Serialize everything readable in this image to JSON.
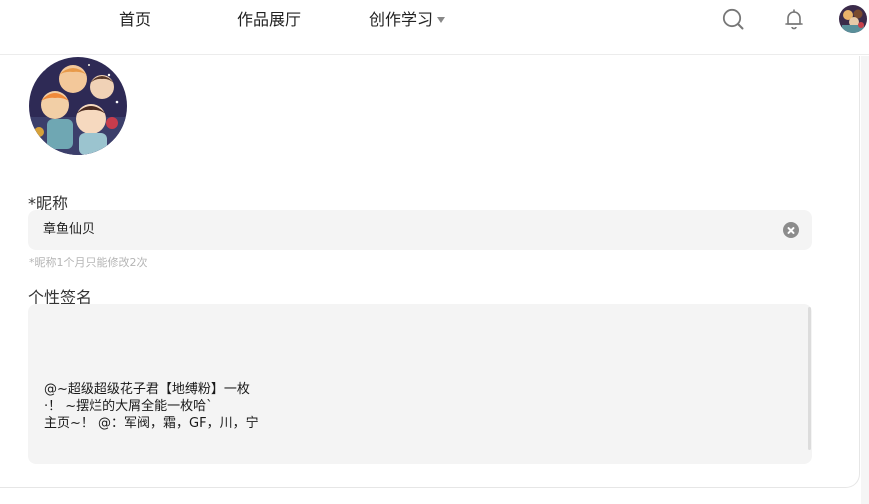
{
  "nav": {
    "home": "首页",
    "gallery": "作品展厅",
    "learn": "创作学习",
    "search_icon": "search-icon",
    "bell_icon": "bell-icon"
  },
  "profile": {
    "nickname_label": "*昵称",
    "nickname_value": "章鱼仙贝",
    "nickname_hint": "*昵称1个月只能修改2次",
    "signature_label": "个性签名",
    "signature_lines": [
      "@~超级超级花子君【地缚粉】一枚",
      "·！ ~摆烂的大屑全能一枚哈`",
      "主页~！ @：军阀，霜，GF，川，宁"
    ]
  },
  "colors": {
    "field_bg": "#f4f4f4",
    "hint": "#b5b5b5",
    "icon_gray": "#8c8c8c"
  }
}
